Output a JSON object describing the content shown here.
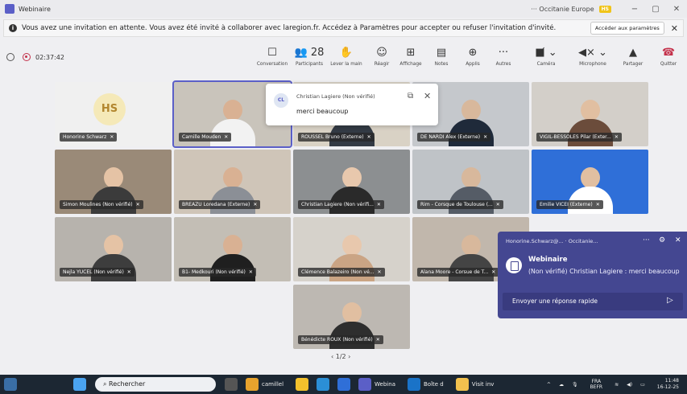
{
  "titlebar": {
    "title": "Webinaire",
    "org": "··· Occitanie Europe",
    "badge": "HS",
    "minimize": "−",
    "maximize": "▢",
    "close": "✕"
  },
  "banner": {
    "message": "Vous avez une invitation en attente. Vous avez été invité à collaborer avec laregion.fr. Accédez à Paramètres pour accepter ou refuser l'invitation d'invité.",
    "button": "Accéder aux paramètres",
    "close": "✕"
  },
  "toolbar": {
    "timer": "02:37:42",
    "tools": [
      {
        "label": "Conversation",
        "icon": "☐"
      },
      {
        "label": "Participants",
        "icon": "👥 28"
      },
      {
        "label": "Lever la main",
        "icon": "✋"
      },
      {
        "label": "Réagir",
        "icon": "☺"
      },
      {
        "label": "Affichage",
        "icon": "⊞"
      },
      {
        "label": "Notes",
        "icon": "▤"
      },
      {
        "label": "Applis",
        "icon": "⊕"
      },
      {
        "label": "Autres",
        "icon": "···"
      },
      {
        "label": "Caméra",
        "icon": "■̸ ⌄"
      },
      {
        "label": "Microphone",
        "icon": "◀× ⌄"
      },
      {
        "label": "Partager",
        "icon": "▲"
      },
      {
        "label": "Quitter",
        "icon": "☎"
      }
    ]
  },
  "participants": [
    {
      "name": "Honorine Schwarz",
      "initials": "HS"
    },
    {
      "name": "Camille Mouden"
    },
    {
      "name": "ROUSSEL Bruno (Externe)"
    },
    {
      "name": "DE NARDI Alex (Externe)"
    },
    {
      "name": "VIGIL-BESSOLES Pilar (Exter..."
    },
    {
      "name": "Simon Moulines (Non vérifié)"
    },
    {
      "name": "BREAZU Loredana (Externe)"
    },
    {
      "name": "Christian Lagiere (Non vérifi..."
    },
    {
      "name": "Rim - Corsque de Toulouse (..."
    },
    {
      "name": "Emilie VICEI (Externe)"
    },
    {
      "name": "Nejla YUCEL (Non vérifié)"
    },
    {
      "name": "B1- Medkouri (Non vérifié)"
    },
    {
      "name": "Clémence Balazeiro (Non vé..."
    },
    {
      "name": "Alana Moore - Corsue de T..."
    },
    {
      "name": "Bénédicte ROUX (Non vérifié)"
    }
  ],
  "chat_popup": {
    "initials": "CL",
    "sender": "Christian Lagiere (Non vérifié)",
    "text": "merci beaucoup",
    "close": "✕"
  },
  "pager": "‹  1/2  ›",
  "toast": {
    "header": "Honorine.Schwarz@... · Occitanie...",
    "more": "···",
    "close": "✕",
    "title": "Webinaire",
    "body": "(Non vérifié) Christian Lagiere : merci beaucoup",
    "reply_placeholder": "Envoyer une réponse rapide",
    "send": "▷"
  },
  "taskbar": {
    "search": "Rechercher",
    "apps": [
      "camillel",
      "Webina",
      "Boîte d",
      "Visit inv"
    ],
    "lang": "FRA",
    "layout": "BEFR",
    "time": "11:48",
    "date": "16-12-25"
  }
}
